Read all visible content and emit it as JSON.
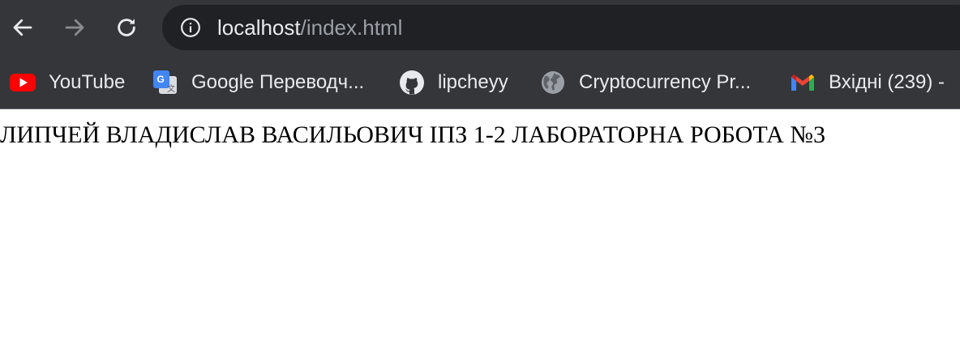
{
  "toolbar": {
    "back_icon": "arrow-left-icon",
    "forward_icon": "arrow-right-icon",
    "reload_icon": "reload-icon",
    "info_icon": "info-icon",
    "url_host": "localhost",
    "url_path": "/index.html"
  },
  "bookmarks": [
    {
      "label": "YouTube",
      "icon": "youtube-icon"
    },
    {
      "label": "Google Переводч...",
      "icon": "google-translate-icon"
    },
    {
      "label": "lipcheyy",
      "icon": "github-icon"
    },
    {
      "label": "Cryptocurrency Pr...",
      "icon": "globe-icon"
    },
    {
      "label": "Вхідні (239) -",
      "icon": "gmail-icon"
    }
  ],
  "page": {
    "heading": "ЛИПЧЕЙ ВЛАДИСЛАВ ВАСИЛЬОВИЧ ІПЗ 1-2 ЛАБОРАТОРНА РОБОТА №3"
  },
  "colors": {
    "chrome_bg": "#35363a",
    "omnibox_bg": "#202124",
    "text_light": "#e8eaed",
    "text_dim": "#9aa0a6"
  }
}
